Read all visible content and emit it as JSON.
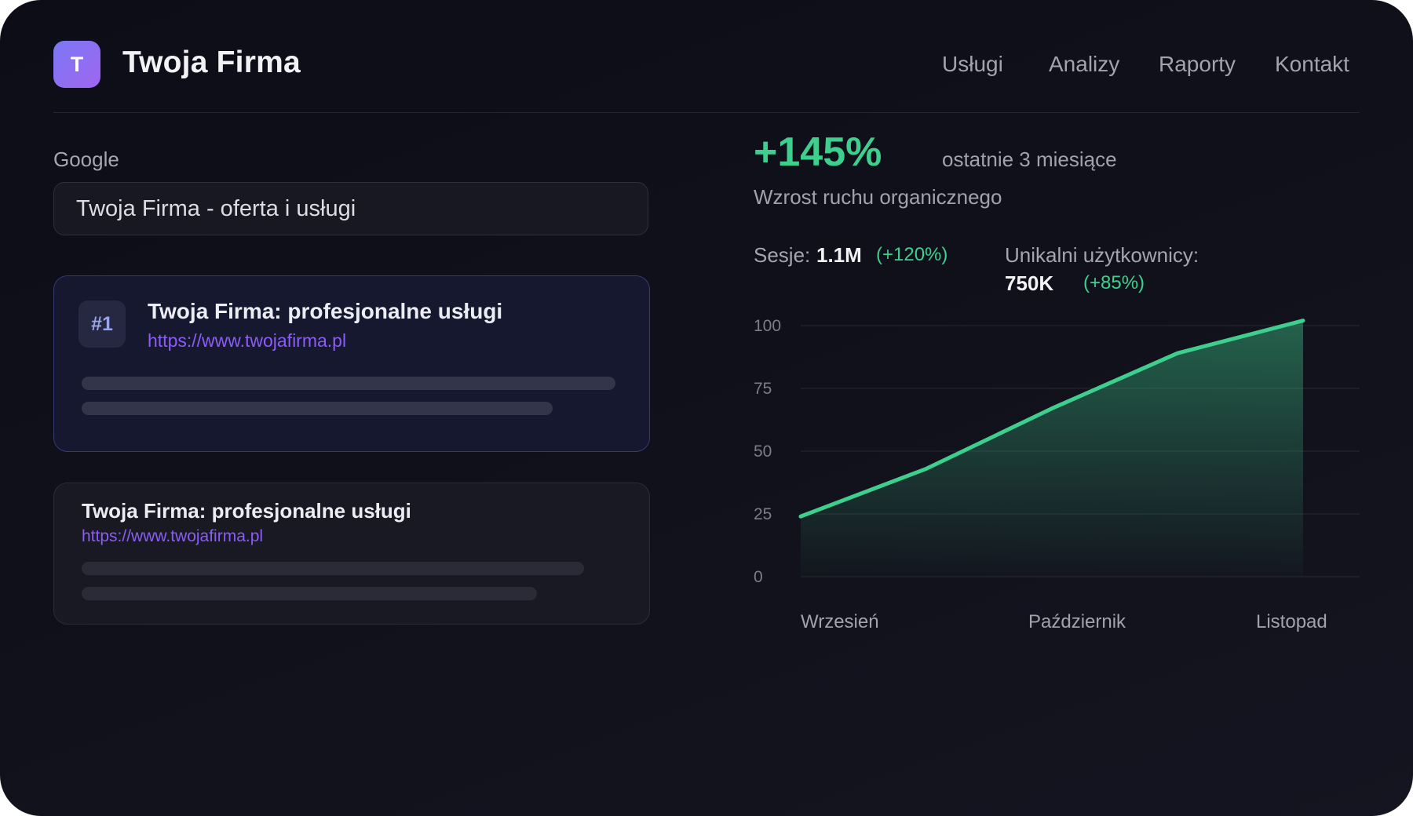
{
  "header": {
    "logo_letter": "T",
    "brand": "Twoja Firma",
    "nav": [
      "Usługi",
      "Analizy",
      "Raporty",
      "Kontakt"
    ]
  },
  "search": {
    "label": "Google",
    "value": "Twoja Firma - oferta i usługi"
  },
  "results": [
    {
      "rank": "#1",
      "title": "Twoja Firma: profesjonalne usługi",
      "url": "https://www.twojafirma.pl"
    },
    {
      "title": "Twoja Firma: profesjonalne usługi",
      "url": "https://www.twojafirma.pl"
    }
  ],
  "stats": {
    "growth": "+145%",
    "period": "ostatnie 3 miesiące",
    "growth_label": "Wzrost ruchu organicznego",
    "sessions_label": "Sesje:",
    "sessions_value": "1.1M",
    "sessions_change": "(+120%)",
    "users_label": "Unikalni użytkownicy:",
    "users_value": "750K",
    "users_change": "(+85%)"
  },
  "colors": {
    "accent_green": "#3ecf8e",
    "accent_purple": "#8b5cf6"
  },
  "chart_data": {
    "type": "area",
    "x_labels": [
      "Wrzesień",
      "Październik",
      "Listopad"
    ],
    "y_ticks": [
      0,
      25,
      50,
      75,
      100
    ],
    "ylim": [
      0,
      100
    ],
    "series": [
      {
        "values": [
          24,
          43,
          67,
          89,
          102
        ]
      }
    ],
    "grid": true
  }
}
